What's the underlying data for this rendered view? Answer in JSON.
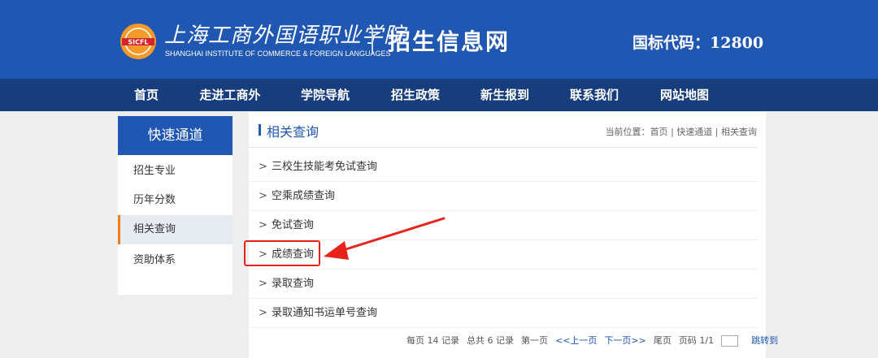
{
  "header": {
    "logo_cn": "上海工商外国语职业学院",
    "logo_en": "SHANGHAI INSTITUTE OF COMMERCE & FOREIGN LANGUAGES",
    "logo_emblem_text": "SICFL",
    "site_title": "招生信息网",
    "code_label": "国标代码：12800"
  },
  "nav": {
    "items": [
      "首页",
      "走进工商外",
      "学院导航",
      "招生政策",
      "新生报到",
      "联系我们",
      "网站地图"
    ]
  },
  "sidebar": {
    "title": "快速通道",
    "items": [
      "招生专业",
      "历年分数",
      "相关查询",
      "资助体系"
    ],
    "active_index": 2
  },
  "main": {
    "title": "相关查询",
    "breadcrumb": {
      "prefix": "当前位置：",
      "items": [
        "首页",
        "快速通道",
        "相关查询"
      ],
      "separator": "|"
    },
    "arrow_symbol": ">",
    "list": [
      "三校生技能考免试查询",
      "空乘成绩查询",
      "免试查询",
      "成绩查询",
      "录取查询",
      "录取通知书运单号查询"
    ],
    "highlighted_index": 3
  },
  "pager": {
    "per_page": "每页 14 记录",
    "total": "总共 6 记录",
    "first": "第一页",
    "prev": "<<上一页",
    "next": "下一页>>",
    "last": "尾页",
    "page": "页码 1/1",
    "jump": "跳转到"
  },
  "colors": {
    "header_blue": "#1f57b2",
    "nav_dark_blue": "#173d7c",
    "active_accent": "#f07c1c",
    "annotation_red": "#e8231a"
  }
}
